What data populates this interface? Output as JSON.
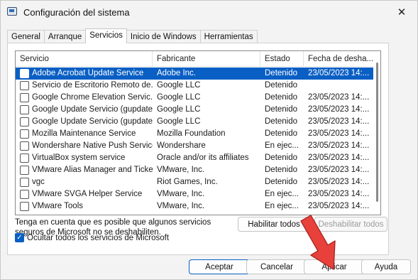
{
  "window": {
    "title": "Configuración del sistema"
  },
  "tabs": [
    "General",
    "Arranque",
    "Servicios",
    "Inicio de Windows",
    "Herramientas"
  ],
  "active_tab": "Servicios",
  "table": {
    "columns": [
      "Servicio",
      "Fabricante",
      "Estado",
      "Fecha de desha..."
    ],
    "rows": [
      {
        "name": "Adobe Acrobat Update Service",
        "vendor": "Adobe Inc.",
        "status": "Detenido",
        "date": "23/05/2023 14:...",
        "selected": true
      },
      {
        "name": "Servicio de Escritorio Remoto de...",
        "vendor": "Google LLC",
        "status": "Detenido",
        "date": ""
      },
      {
        "name": "Google Chrome Elevation Servic...",
        "vendor": "Google LLC",
        "status": "Detenido",
        "date": "23/05/2023 14:..."
      },
      {
        "name": "Google Update Servicio (gupdate)",
        "vendor": "Google LLC",
        "status": "Detenido",
        "date": "23/05/2023 14:..."
      },
      {
        "name": "Google Update Servicio (gupdate)",
        "vendor": "Google LLC",
        "status": "Detenido",
        "date": "23/05/2023 14:..."
      },
      {
        "name": "Mozilla Maintenance Service",
        "vendor": "Mozilla Foundation",
        "status": "Detenido",
        "date": "23/05/2023 14:..."
      },
      {
        "name": "Wondershare Native Push Service",
        "vendor": "Wondershare",
        "status": "En ejec...",
        "date": "23/05/2023 14:..."
      },
      {
        "name": "VirtualBox system service",
        "vendor": "Oracle and/or its affiliates",
        "status": "Detenido",
        "date": "23/05/2023 14:..."
      },
      {
        "name": "VMware Alias Manager and Ticke...",
        "vendor": "VMware, Inc.",
        "status": "Detenido",
        "date": "23/05/2023 14:..."
      },
      {
        "name": "vgc",
        "vendor": "Riot Games, Inc.",
        "status": "Detenido",
        "date": "23/05/2023 14:..."
      },
      {
        "name": "VMware SVGA Helper Service",
        "vendor": "VMware, Inc.",
        "status": "En ejec...",
        "date": "23/05/2023 14:..."
      },
      {
        "name": "VMware Tools",
        "vendor": "VMware, Inc.",
        "status": "En ejec...",
        "date": "23/05/2023 14:..."
      }
    ]
  },
  "note": "Tenga en cuenta que es posible que algunos servicios seguros de Microsoft no se deshabiliten.",
  "buttons": {
    "enable_all": "Habilitar todos",
    "disable_all": "Deshabilitar todos",
    "ok": "Aceptar",
    "cancel": "Cancelar",
    "apply": "Aplicar",
    "help": "Ayuda"
  },
  "hide_microsoft": {
    "label": "Ocultar todos los servicios de Microsoft",
    "checked": true
  },
  "colors": {
    "selection": "#0a5fc4",
    "arrow": "#e8413c"
  },
  "icons": {
    "app": "system-config-icon",
    "close": "close-icon",
    "checkmark": "checkmark-icon"
  }
}
